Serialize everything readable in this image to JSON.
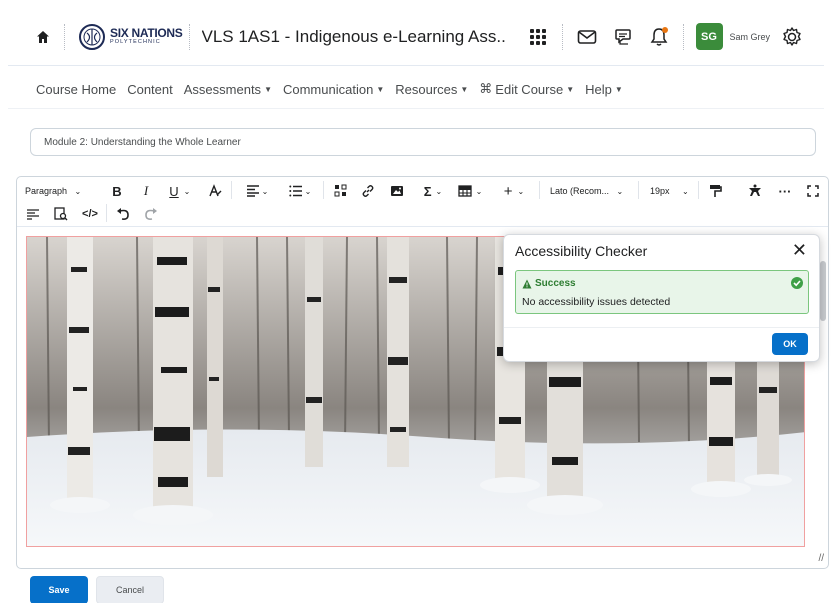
{
  "header": {
    "logo_main": "SIX NATIONS",
    "logo_sub": "POLYTECHNIC",
    "course_title": "VLS 1AS1 - Indigenous e-Learning Ass...",
    "avatar_initials": "SG",
    "username": "Sam Grey",
    "notification_color": "#e87511",
    "avatar_color": "#3b8c3b"
  },
  "nav": {
    "items": [
      {
        "label": "Course Home",
        "dropdown": false
      },
      {
        "label": "Content",
        "dropdown": false
      },
      {
        "label": "Assessments",
        "dropdown": true
      },
      {
        "label": "Communication",
        "dropdown": true
      },
      {
        "label": "Resources",
        "dropdown": true
      },
      {
        "label": "Edit Course",
        "dropdown": true
      },
      {
        "label": "Help",
        "dropdown": true
      }
    ],
    "chevron": "⌄"
  },
  "title_field": {
    "value": "Module 2: Understanding the Whole Learner"
  },
  "toolbar": {
    "paragraph": "Paragraph",
    "bold": "B",
    "italic": "I",
    "underline": "U",
    "font": "Lato (Recom...",
    "size": "19px",
    "sigma": "Σ",
    "plus": "+",
    "more": "···"
  },
  "dialog": {
    "title": "Accessibility Checker",
    "success_label": "Success",
    "message": "No accessibility issues detected",
    "ok_label": "OK"
  },
  "footer": {
    "save_label": "Save",
    "cancel_label": "Cancel"
  },
  "colors": {
    "primary": "#0670c9",
    "success_bg": "#e8f5e9",
    "success_border": "#7bc67e",
    "success_text": "#2e7d32"
  }
}
